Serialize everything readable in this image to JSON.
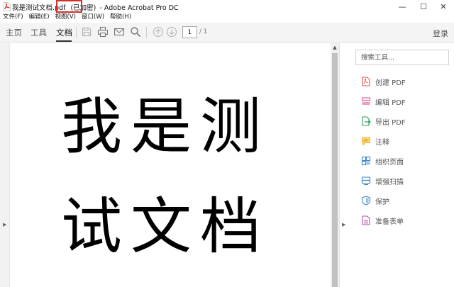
{
  "window": {
    "title_file": "我是测试文档.pdf",
    "title_status": "(已加密)",
    "title_app": "- Adobe Acrobat Pro DC",
    "controls": {
      "minimize": "—",
      "maximize": "☐",
      "close": "✕"
    }
  },
  "menu": [
    "文件(F)",
    "编辑(E)",
    "视图(V)",
    "窗口(W)",
    "帮助(H)"
  ],
  "toolbar": {
    "tabs": [
      {
        "label": "主页"
      },
      {
        "label": "工具"
      },
      {
        "label": "文档",
        "active": true
      }
    ],
    "icons": [
      "save-icon",
      "print-icon",
      "email-icon",
      "search-icon",
      "page-up-icon",
      "page-down-icon"
    ],
    "page_current": "1",
    "page_total": "/ 1",
    "login_label": "登录"
  },
  "document": {
    "lines": [
      "我是测",
      "试文档"
    ]
  },
  "tools_panel": {
    "search_placeholder": "搜索工具...",
    "items": [
      {
        "label": "创建 PDF",
        "icon": "create-pdf-icon",
        "color": "#e8544a"
      },
      {
        "label": "编辑 PDF",
        "icon": "edit-pdf-icon",
        "color": "#e0508a"
      },
      {
        "label": "导出 PDF",
        "icon": "export-pdf-icon",
        "color": "#2c9e5f"
      },
      {
        "label": "注释",
        "icon": "comment-icon",
        "color": "#f2b632"
      },
      {
        "label": "组织页面",
        "icon": "organize-pages-icon",
        "color": "#3a87c8"
      },
      {
        "label": "增强扫描",
        "icon": "enhance-scan-icon",
        "color": "#3a87c8"
      },
      {
        "label": "保护",
        "icon": "protect-icon",
        "color": "#3a87c8"
      },
      {
        "label": "准备表单",
        "icon": "prepare-form-icon",
        "color": "#b04fa8"
      }
    ]
  },
  "colors": {
    "highlight_border": "#d32f2f",
    "toolbar_bg": "#f4f4f4",
    "doc_background": "#e9e9e9"
  }
}
